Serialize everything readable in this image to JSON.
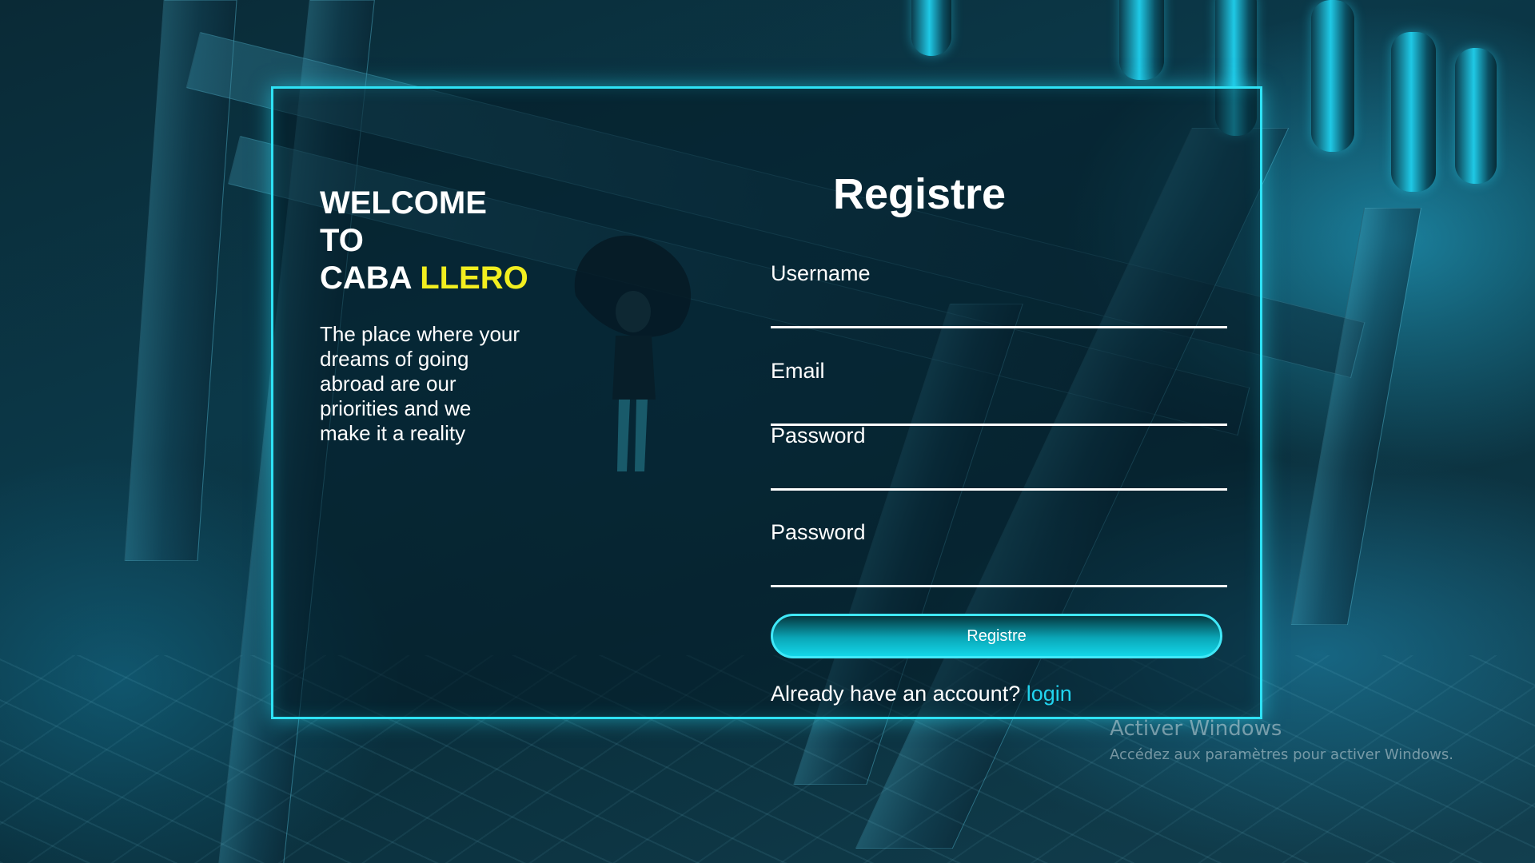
{
  "welcome": {
    "line1": "WELCOME",
    "line2": "TO",
    "line3_plain": "CABA ",
    "line3_accent": "LLERO"
  },
  "tagline": "The place where your dreams of going abroad are our priorities and we make it a reality",
  "form": {
    "title": "Registre",
    "username_label": "Username",
    "username_value": "",
    "email_label": "Email",
    "email_value": "",
    "password_label": "Password",
    "password_value": "",
    "confirm_password_label": "Password",
    "confirm_password_value": "",
    "submit_label": "Registre",
    "account_prompt": "Already have an account? ",
    "login_link": "login"
  },
  "watermark": {
    "title": "Activer Windows",
    "subtitle": "Accédez aux paramètres pour activer Windows."
  },
  "colors": {
    "accent_yellow": "#f2ee1f",
    "card_border": "#2ee2f5",
    "link": "#21d4ef"
  }
}
